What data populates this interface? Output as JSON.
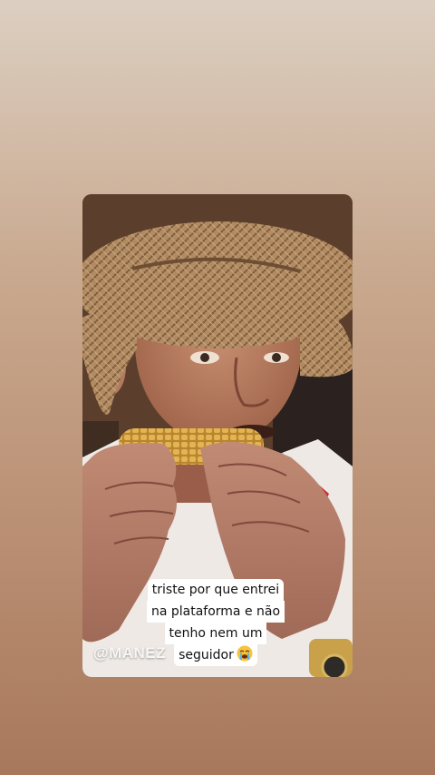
{
  "story": {
    "watermark": "@MANEZ",
    "caption_lines": [
      "triste por que entrei",
      "na plataforma e não",
      "tenho nem um",
      "seguidor"
    ],
    "caption_emoji": "loudly-crying-face-icon"
  },
  "colors": {
    "background_top": "#dccfc1",
    "background_bottom": "#a8785c",
    "caption_bg": "#ffffff",
    "caption_text": "#111111"
  }
}
